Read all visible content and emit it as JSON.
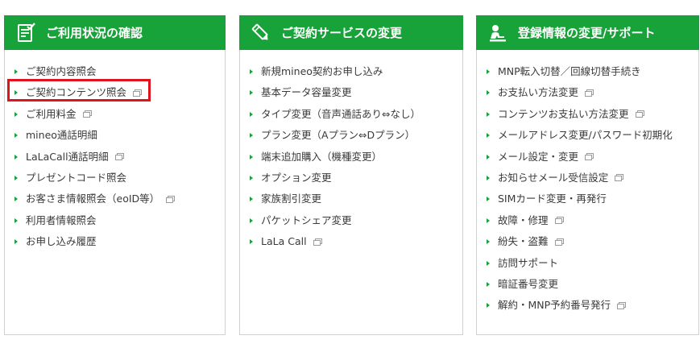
{
  "panels": [
    {
      "title": "ご利用状況の確認",
      "icon": "document-check-icon",
      "items": [
        {
          "label": "ご契約内容照会",
          "external": false
        },
        {
          "label": "ご契約コンテンツ照会",
          "external": true
        },
        {
          "label": "ご利用料金",
          "external": true
        },
        {
          "label": "mineo通話明細",
          "external": false
        },
        {
          "label": "LaLaCall通話明細",
          "external": true
        },
        {
          "label": "プレゼントコード照会",
          "external": false
        },
        {
          "label": "お客さま情報照会（eoID等）",
          "external": true
        },
        {
          "label": "利用者情報照会",
          "external": false
        },
        {
          "label": "お申し込み履歴",
          "external": false
        }
      ]
    },
    {
      "title": "ご契約サービスの変更",
      "icon": "pencil-icon",
      "items": [
        {
          "label": "新規mineo契約お申し込み",
          "external": false
        },
        {
          "label": "基本データ容量変更",
          "external": false
        },
        {
          "label": "タイプ変更（音声通話あり⇔なし）",
          "external": false
        },
        {
          "label": "プラン変更（Aプラン⇔Dプラン）",
          "external": false
        },
        {
          "label": "端末追加購入（機種変更）",
          "external": false
        },
        {
          "label": "オプション変更",
          "external": false
        },
        {
          "label": "家族割引変更",
          "external": false
        },
        {
          "label": "パケットシェア変更",
          "external": false
        },
        {
          "label": "LaLa Call",
          "external": true
        }
      ]
    },
    {
      "title": "登録情報の変更/サポート",
      "icon": "person-desk-icon",
      "items": [
        {
          "label": "MNP転入切替／回線切替手続き",
          "external": false
        },
        {
          "label": "お支払い方法変更",
          "external": true
        },
        {
          "label": "コンテンツお支払い方法変更",
          "external": true
        },
        {
          "label": "メールアドレス変更/パスワード初期化",
          "external": false
        },
        {
          "label": "メール設定・変更",
          "external": true
        },
        {
          "label": "お知らせメール受信設定",
          "external": true
        },
        {
          "label": "SIMカード変更・再発行",
          "external": false
        },
        {
          "label": "故障・修理",
          "external": true
        },
        {
          "label": "紛失・盗難",
          "external": true
        },
        {
          "label": "訪問サポート",
          "external": false
        },
        {
          "label": "暗証番号変更",
          "external": false
        },
        {
          "label": "解約・MNP予約番号発行",
          "external": true
        }
      ]
    }
  ],
  "colors": {
    "header_bg": "#17a23a",
    "highlight_border": "#e0141e"
  }
}
